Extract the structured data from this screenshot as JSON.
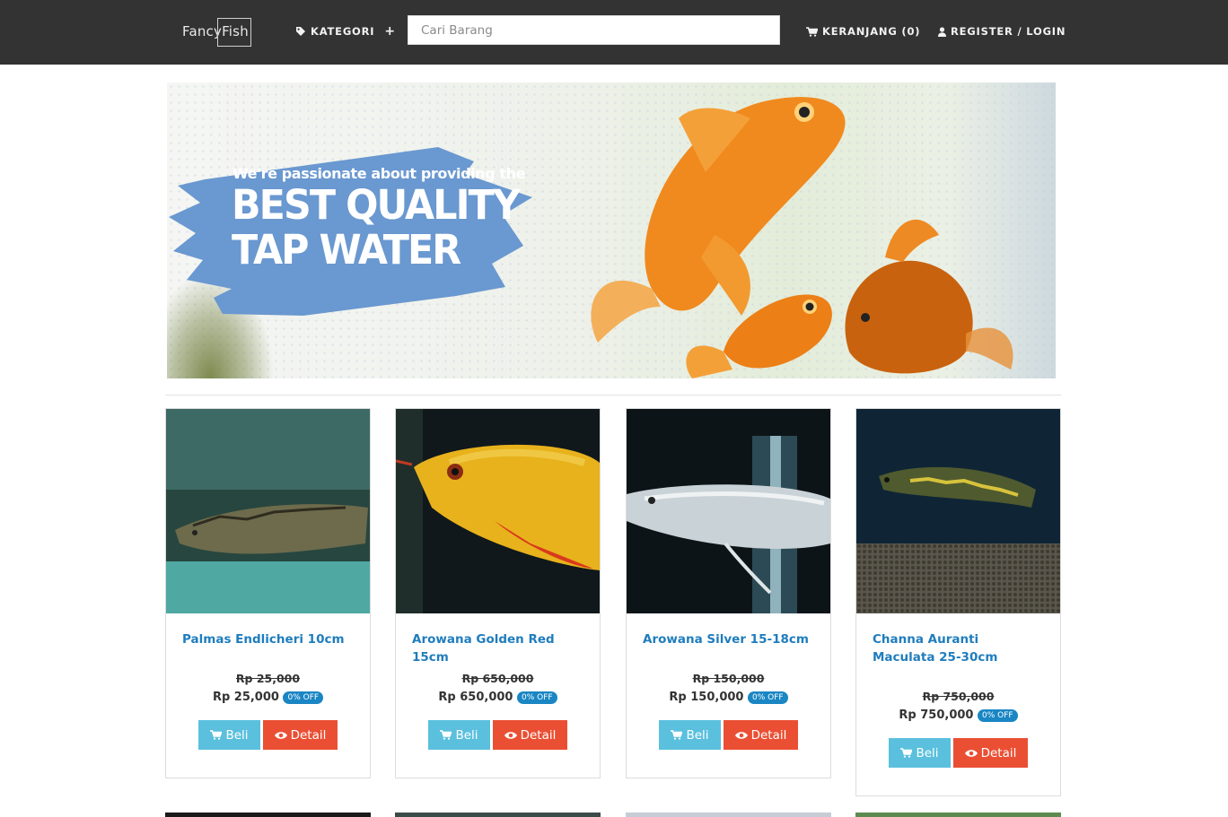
{
  "header": {
    "logo": "FancyFish",
    "kategori_label": "KATEGORI",
    "search_placeholder": "Cari Barang",
    "cart_label": "KERANJANG (0)",
    "login_label": "REGISTER / LOGIN"
  },
  "banner": {
    "line1": "We're passionate about providing the",
    "line2": "BEST QUALITY",
    "line3": "TAP WATER"
  },
  "products": [
    {
      "name": "Palmas Endlicheri 10cm",
      "old_price": "Rp 25,000",
      "price": "Rp 25,000",
      "discount": "0% OFF",
      "buy_label": "Beli",
      "detail_label": "Detail"
    },
    {
      "name": "Arowana Golden Red 15cm",
      "old_price": "Rp 650,000",
      "price": "Rp 650,000",
      "discount": "0% OFF",
      "buy_label": "Beli",
      "detail_label": "Detail"
    },
    {
      "name": "Arowana Silver 15-18cm",
      "old_price": "Rp 150,000",
      "price": "Rp 150,000",
      "discount": "0% OFF",
      "buy_label": "Beli",
      "detail_label": "Detail"
    },
    {
      "name": "Channa Auranti Maculata 25-30cm",
      "old_price": "Rp 750,000",
      "price": "Rp 750,000",
      "discount": "0% OFF",
      "buy_label": "Beli",
      "detail_label": "Detail"
    }
  ],
  "colors": {
    "topbar": "#333333",
    "link": "#1f7dbd",
    "buy": "#5bc0de",
    "detail": "#ea4f34",
    "badge": "#1a86c4"
  }
}
